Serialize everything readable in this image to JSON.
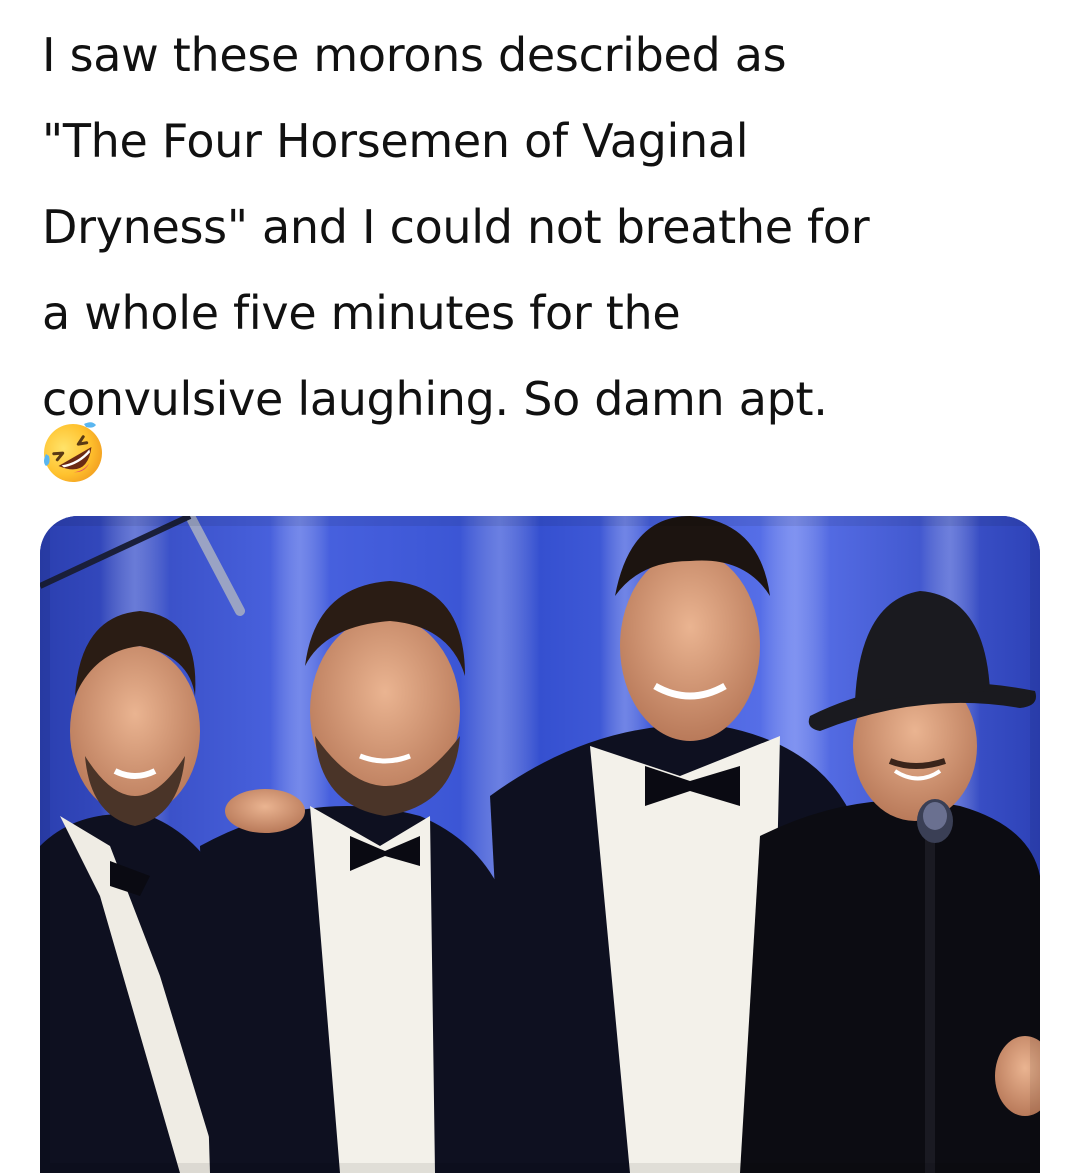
{
  "post": {
    "text_lines": [
      "I saw these morons described as",
      "\"The Four Horsemen of Vaginal",
      "Dryness\" and I could not breathe for",
      "a whole five minutes for the",
      "convulsive laughing. So damn apt."
    ],
    "emoji": "rolling-on-floor-laughing-emoji"
  },
  "photo": {
    "subject": "four-men-on-stage-photo",
    "colors": {
      "curtain": "#3a55d0",
      "tuxedo": "#0e1020",
      "shirt": "#f3f1ea",
      "skin": "#d9a07f",
      "hat": "#1a1a1f"
    }
  }
}
